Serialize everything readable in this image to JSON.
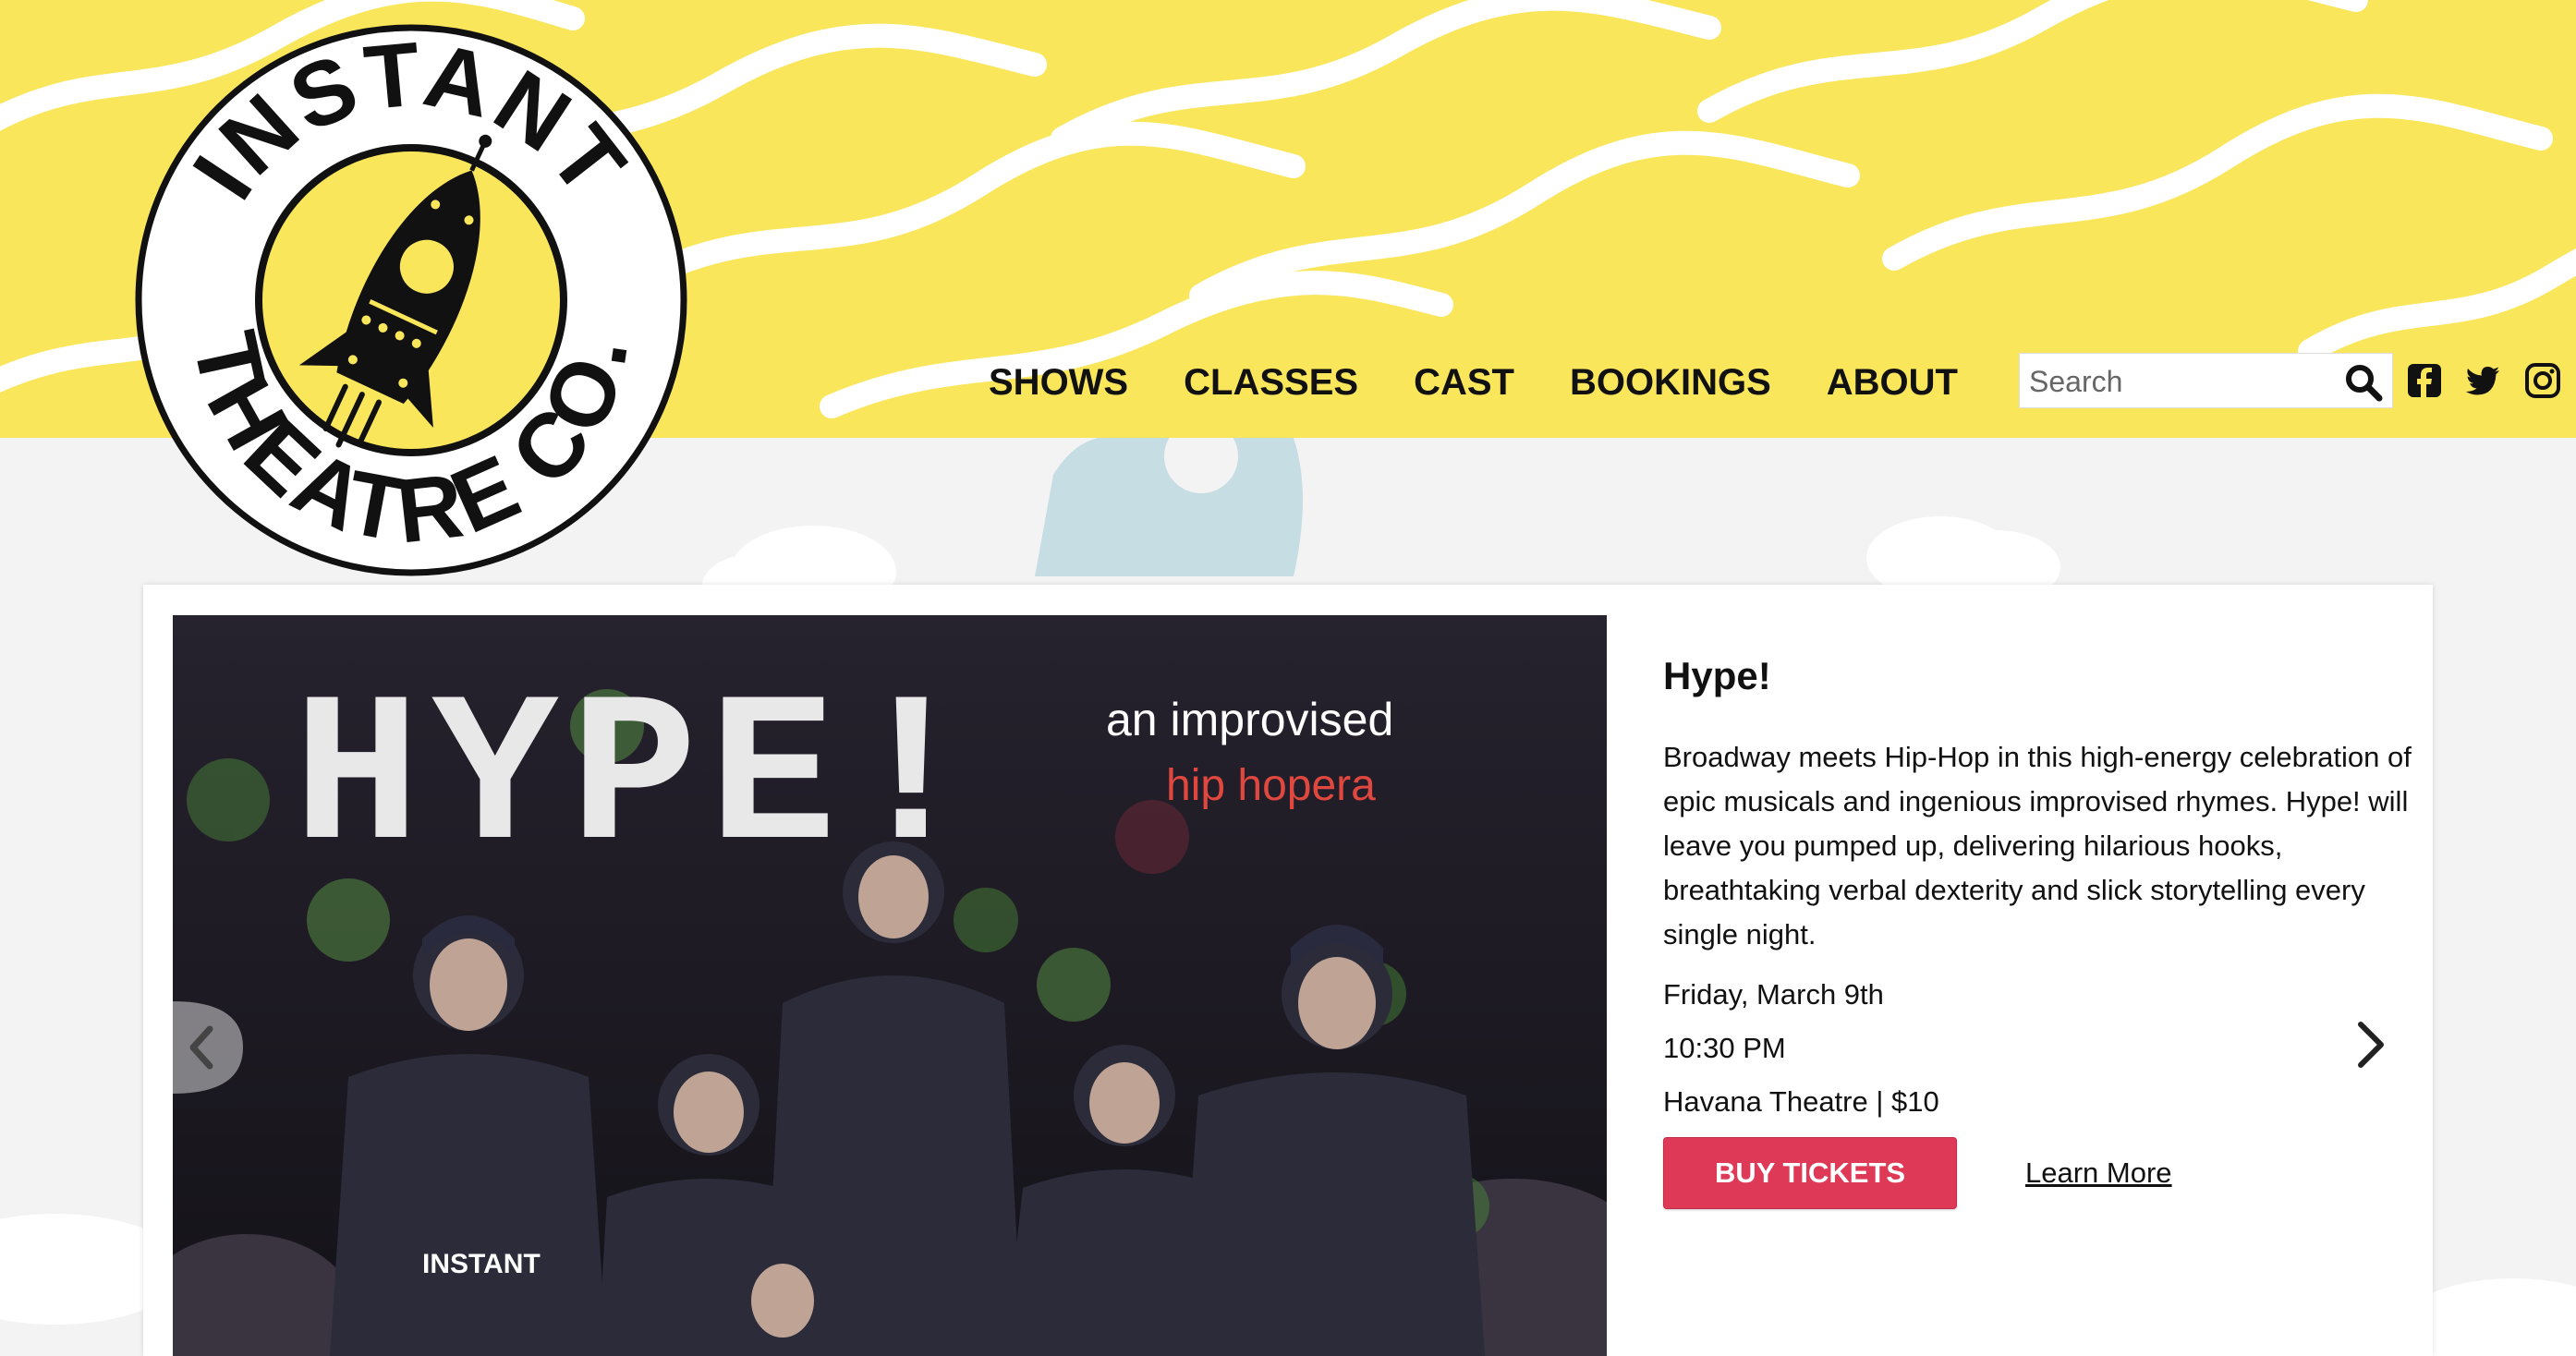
{
  "brand": {
    "logo_top": "INSTANT",
    "logo_bottom": "THEATRE CO."
  },
  "nav": {
    "items": [
      "SHOWS",
      "CLASSES",
      "CAST",
      "BOOKINGS",
      "ABOUT"
    ]
  },
  "search": {
    "placeholder": "Search",
    "icon": "search-icon"
  },
  "social": [
    "facebook-icon",
    "twitter-icon",
    "instagram-icon"
  ],
  "colors": {
    "header_bg": "#f9e65b",
    "page_bg": "#f3f3f3",
    "buy_button": "#de3a57"
  },
  "slide": {
    "poster_title": "HYPE!",
    "poster_tagline_1": "an improvised",
    "poster_tagline_2": "hip hopera",
    "shirt_text": "INSTANT",
    "title": "Hype!",
    "description": "Broadway meets Hip-Hop in this high-energy celebration of epic musicals and ingenious improvised rhymes. Hype! will leave you pumped up, delivering hilarious hooks, breathtaking verbal dexterity and slick storytelling every single night.",
    "date": "Friday, March 9th",
    "time": "10:30 PM",
    "venue": "Havana Theatre | $10",
    "buy_label": "BUY TICKETS",
    "learn_label": "Learn More"
  }
}
